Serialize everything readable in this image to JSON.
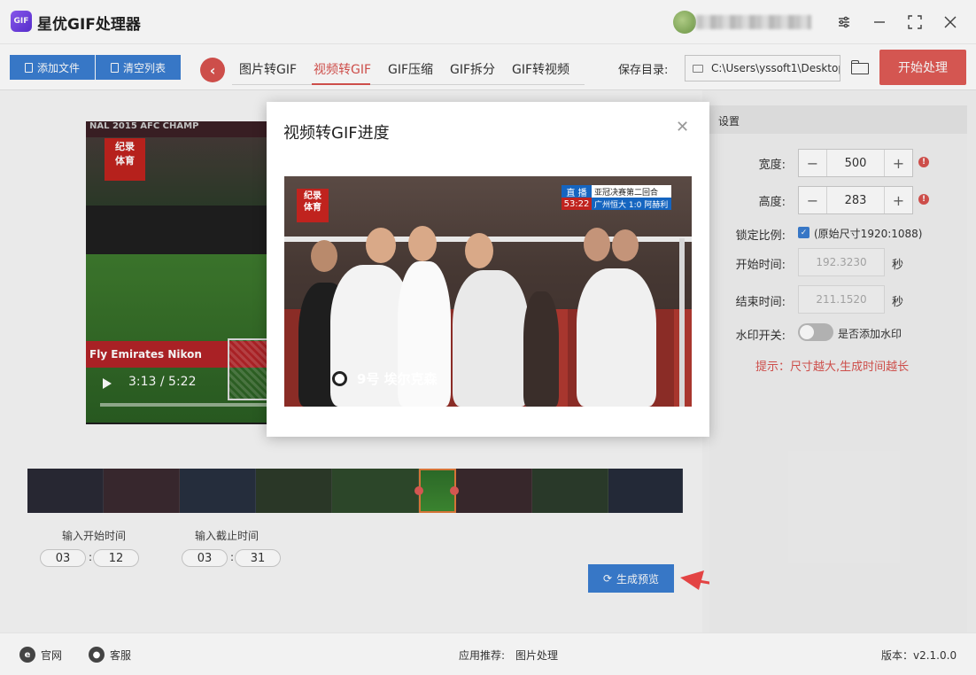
{
  "app": {
    "title": "星优GIF处理器",
    "logo_text": "GIF"
  },
  "toolbar": {
    "add_file": "添加文件",
    "clear_list": "清空列表",
    "tabs": [
      "图片转GIF",
      "视频转GIF",
      "GIF压缩",
      "GIF拆分",
      "GIF转视频"
    ],
    "active_tab": "视频转GIF",
    "save_dir_label": "保存目录:",
    "save_dir_value": "C:\\Users\\yssoft1\\Desktop",
    "start_button": "开始处理"
  },
  "player": {
    "top_banner": "NAL 2015   AFC CHAMP",
    "logo": "纪录\n体育",
    "ads": "Fly Emirates   Nikon",
    "time": "3:13 / 5:22",
    "progress": 0.6
  },
  "clip": {
    "start_label": "输入开始时间",
    "end_label": "输入截止时间",
    "start_min": "03",
    "start_sec": "12",
    "end_min": "03",
    "end_sec": "31",
    "generate_button": "生成预览"
  },
  "settings": {
    "header": "设置",
    "width_label": "宽度:",
    "width_value": "500",
    "height_label": "高度:",
    "height_value": "283",
    "lock_label": "锁定比例:",
    "lock_checked": true,
    "original_size": "(原始尺寸1920:1088)",
    "start_time_label": "开始时间:",
    "start_time_value": "192.3230",
    "end_time_label": "结束时间:",
    "end_time_value": "211.1520",
    "unit_seconds": "秒",
    "watermark_label": "水印开关:",
    "watermark_toggle_text": "是否添加水印",
    "watermark_on": false,
    "hint": "提示：尺寸越大,生成时间越长"
  },
  "modal": {
    "title": "视频转GIF进度",
    "preview": {
      "logo": "纪录\n体育",
      "live": "直 播",
      "clock": "53:22",
      "match": "亚冠决赛第二回合",
      "result": "广州恒大 1:0 阿赫利",
      "caption": "9号  埃尔克森"
    }
  },
  "footer": {
    "website": "官网",
    "support": "客服",
    "recommend_label": "应用推荐:",
    "recommend_value": "图片处理",
    "version": "版本：v2.1.0.0"
  },
  "colors": {
    "accent_red": "#e05b56",
    "accent_blue": "#3a7ed1",
    "hint_red": "#d9534f"
  }
}
